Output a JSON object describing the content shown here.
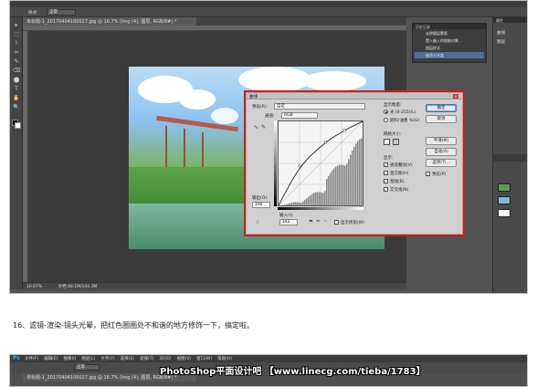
{
  "screenshot1": {
    "doc_tab": "未标题-1_20170404100027.jpg @ 16.7% (Img (4), 图层, RGB/8#) *",
    "options": {
      "mode_label": "样式:",
      "mode_value": "正常"
    },
    "status": {
      "zoom": "16.67%",
      "doc_size": "文档:48.1M/144.3M"
    },
    "history_panel": {
      "title": "历史记录",
      "items": [
        "去除图层蒙版",
        "置入嵌入的智能对象",
        "图层样式",
        "曲线与光度"
      ]
    },
    "side_panel": {
      "title": "属性",
      "items": [
        "曲线",
        "图层"
      ]
    },
    "tools": [
      "▸",
      "⬚",
      "⌇",
      "✂",
      "✎",
      "⌫",
      "⬤",
      "T",
      "✋",
      "🔍"
    ]
  },
  "curves_dialog": {
    "title": "曲线",
    "preset_label": "预设(R):",
    "preset_value": "自定",
    "channel_label": "通道:",
    "channel_value": "RGB",
    "output_label": "输出(O):",
    "output_value": "192",
    "input_label": "输入(I):",
    "input_value": "142",
    "show_amount_label": "显示数量:",
    "light_option": "光 (0-255)(L)",
    "pigment_option": "颜料/油墨 %(G)",
    "grid_size_label": "网格大小:",
    "show_label": "显示:",
    "checkboxes": [
      "通道叠加(V)",
      "直方图(H)",
      "基线(B)",
      "交叉线(N)"
    ],
    "clipping_label": "显示修剪(W)",
    "buttons": {
      "ok": "确定",
      "cancel": "取消",
      "smooth": "平滑(M)",
      "auto": "自动(A)",
      "options": "选项(T)...",
      "preview": "预览(P)"
    },
    "curve": [
      [
        0,
        0
      ],
      [
        64,
        120
      ],
      [
        142,
        192
      ],
      [
        200,
        228
      ],
      [
        255,
        255
      ]
    ]
  },
  "caption": "16、滤镜-渲染-镜头光晕，把红色圈圈处不和谐的地方修饰一下，搞定啦。",
  "screenshot2": {
    "menu": [
      "文件(F)",
      "编辑(E)",
      "图像(I)",
      "图层(L)",
      "文字(Y)",
      "选择(S)",
      "滤镜(T)",
      "3D(D)",
      "视图(V)",
      "窗口(W)",
      "帮助(H)"
    ],
    "option_mode": "正常",
    "doc_tab": "未标题-1_20170404100027.jpg @ 16.7% (Img (4), 图层, RGB/8#) *"
  },
  "watermark": "PhotoShop平面设计吧 【www.linecg.com/tieba/1783】",
  "colors": {
    "highlight_box": "#d01b1b",
    "ps_dark": "#535353",
    "history_select": "#4f6e9f"
  }
}
